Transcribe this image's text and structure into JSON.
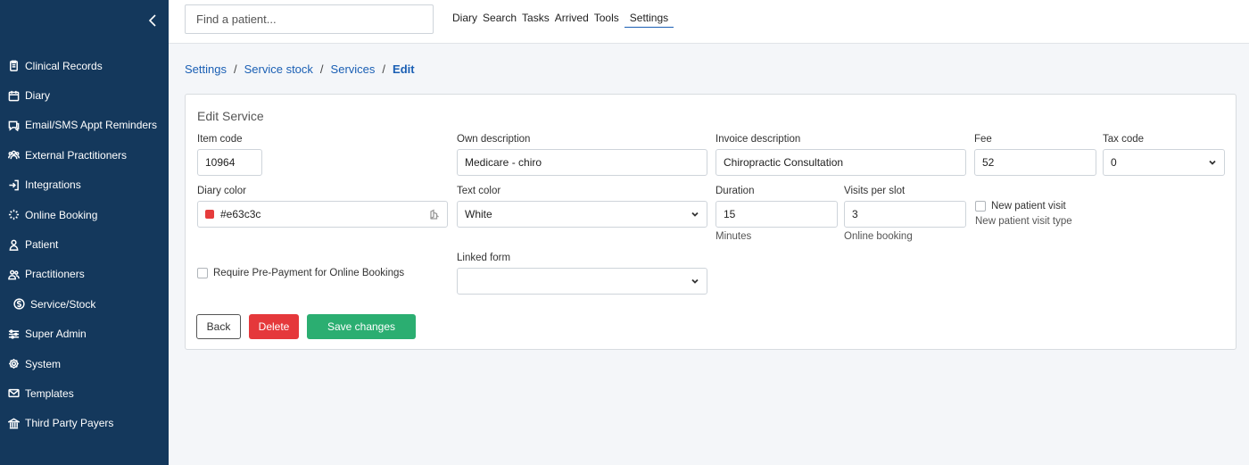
{
  "sidebar": {
    "items": [
      {
        "label": "Clinical Records",
        "icon": "clipboard-icon"
      },
      {
        "label": "Diary",
        "icon": "calendar-icon"
      },
      {
        "label": "Email/SMS Appt Reminders",
        "icon": "chat-icon"
      },
      {
        "label": "External Practitioners",
        "icon": "people-group-icon"
      },
      {
        "label": "Integrations",
        "icon": "sign-in-icon"
      },
      {
        "label": "Online Booking",
        "icon": "sparkle-icon"
      },
      {
        "label": "Patient",
        "icon": "person-icon"
      },
      {
        "label": "Practitioners",
        "icon": "people-icon"
      },
      {
        "label": "Service/Stock",
        "icon": "dollar-circle-icon"
      },
      {
        "label": "Super Admin",
        "icon": "sliders-icon"
      },
      {
        "label": "System",
        "icon": "gear-icon"
      },
      {
        "label": "Templates",
        "icon": "envelope-icon"
      },
      {
        "label": "Third Party Payers",
        "icon": "bank-icon"
      }
    ]
  },
  "header": {
    "search_placeholder": "Find a patient...",
    "nav": [
      "Diary",
      "Search",
      "Tasks",
      "Arrived",
      "Tools",
      "Settings"
    ],
    "active_nav": "Settings"
  },
  "breadcrumb": {
    "items": [
      "Settings",
      "Service stock",
      "Services"
    ],
    "current": "Edit"
  },
  "form": {
    "title": "Edit Service",
    "item_code": {
      "label": "Item code",
      "value": "10964"
    },
    "own_description": {
      "label": "Own description",
      "value": "Medicare - chiro"
    },
    "invoice_description": {
      "label": "Invoice description",
      "value": "Chiropractic Consultation"
    },
    "fee": {
      "label": "Fee",
      "value": "52"
    },
    "tax_code": {
      "label": "Tax code",
      "value": "0"
    },
    "diary_color": {
      "label": "Diary color",
      "value": "#e63c3c",
      "swatch": "#e63c3c"
    },
    "text_color": {
      "label": "Text color",
      "value": "White"
    },
    "duration": {
      "label": "Duration",
      "value": "15",
      "hint": "Minutes"
    },
    "visits_per_slot": {
      "label": "Visits per slot",
      "value": "3",
      "hint": "Online booking"
    },
    "new_patient_visit": {
      "label": "New patient visit",
      "hint": "New patient visit type",
      "checked": false
    },
    "require_prepayment": {
      "label": "Require Pre-Payment for Online Bookings",
      "checked": false
    },
    "linked_form": {
      "label": "Linked form",
      "value": ""
    }
  },
  "buttons": {
    "back": "Back",
    "delete": "Delete",
    "save": "Save changes"
  },
  "colors": {
    "sidebar_bg": "#14385c",
    "link": "#1a5fb4",
    "delete": "#e5383b",
    "save": "#2bae71"
  }
}
